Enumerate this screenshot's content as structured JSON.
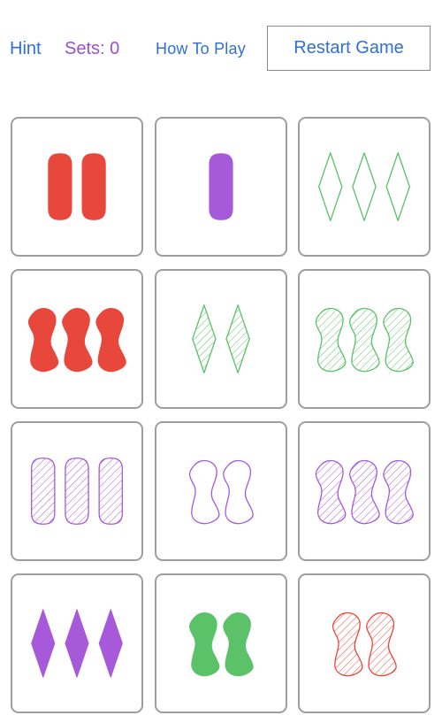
{
  "toolbar": {
    "hint_label": "Hint",
    "sets_label": "Sets: 0",
    "how_to_play_label": "How To Play",
    "restart_label": "Restart Game"
  },
  "colors": {
    "red": "#e8483c",
    "purple": "#a65ad9",
    "green": "#5cc26a",
    "link_blue": "#2f6fd6",
    "sets_purple": "#9b4fd1",
    "card_border": "#9e9e9e"
  },
  "cards": [
    {
      "count": 2,
      "shape": "oval",
      "color": "red",
      "fill": "solid"
    },
    {
      "count": 1,
      "shape": "oval",
      "color": "purple",
      "fill": "solid"
    },
    {
      "count": 3,
      "shape": "diamond",
      "color": "green",
      "fill": "open"
    },
    {
      "count": 3,
      "shape": "squiggle",
      "color": "red",
      "fill": "solid"
    },
    {
      "count": 2,
      "shape": "diamond",
      "color": "green",
      "fill": "striped"
    },
    {
      "count": 3,
      "shape": "squiggle",
      "color": "green",
      "fill": "striped"
    },
    {
      "count": 3,
      "shape": "oval",
      "color": "purple",
      "fill": "striped"
    },
    {
      "count": 2,
      "shape": "squiggle",
      "color": "purple",
      "fill": "open"
    },
    {
      "count": 3,
      "shape": "squiggle",
      "color": "purple",
      "fill": "striped"
    },
    {
      "count": 3,
      "shape": "diamond",
      "color": "purple",
      "fill": "solid"
    },
    {
      "count": 2,
      "shape": "squiggle",
      "color": "green",
      "fill": "solid"
    },
    {
      "count": 2,
      "shape": "squiggle",
      "color": "red",
      "fill": "striped"
    }
  ]
}
